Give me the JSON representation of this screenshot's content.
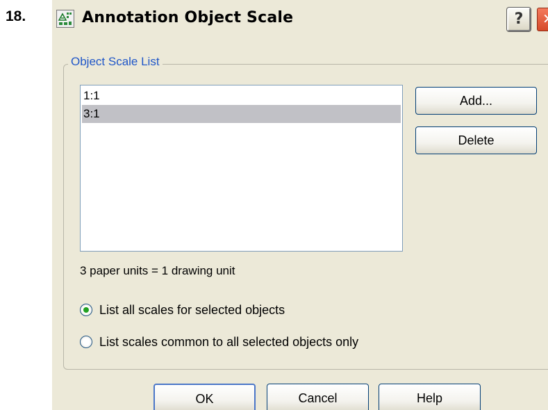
{
  "step_number": "18.",
  "window": {
    "title": "Annotation Object Scale",
    "help_glyph": "?",
    "close_glyph": "✕",
    "app_icon": "annotation-scale-icon"
  },
  "group": {
    "label": "Object Scale List"
  },
  "scale_list": {
    "items": [
      "1:1",
      "3:1"
    ],
    "selected": "3:1"
  },
  "buttons": {
    "add": "Add...",
    "delete": "Delete",
    "ok": "OK",
    "cancel": "Cancel",
    "help": "Help"
  },
  "ratio_text": "3 paper units = 1 drawing unit",
  "options": {
    "list_all": "List all scales for selected objects",
    "list_common": "List scales common to all selected objects only",
    "selected": "list_all"
  },
  "colors": {
    "dialog_bg": "#ece9d8",
    "group_label": "#1f56c8",
    "selection": "#c1c1c6",
    "radio_dot": "#21a121"
  }
}
